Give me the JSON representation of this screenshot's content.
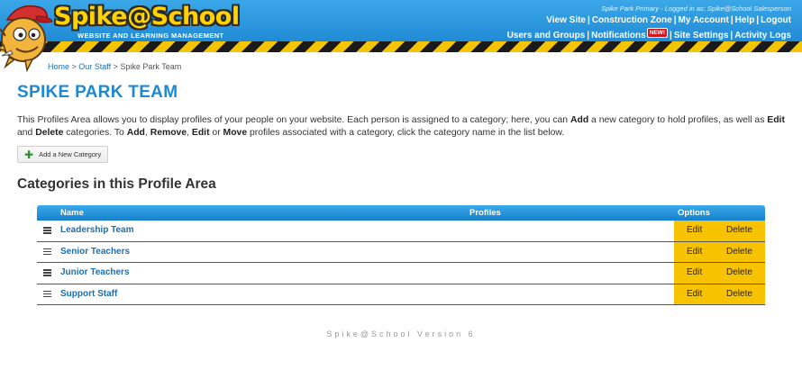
{
  "header": {
    "logo_main": "Spike@School",
    "logo_sub": "WEBSITE AND LEARNING MANAGEMENT",
    "user_info": "Spike Park Primary - Logged in as: Spike@School Salesperson",
    "nav_row1": [
      "View Site",
      "Construction Zone",
      "My Account",
      "Help",
      "Logout"
    ],
    "nav_row2": {
      "users_groups": "Users and Groups",
      "notifications": "Notifications",
      "new_badge": "NEW!",
      "site_settings": "Site Settings",
      "activity_logs": "Activity Logs"
    }
  },
  "breadcrumb": {
    "home": "Home",
    "sep1": " > ",
    "staff": "Our Staff",
    "sep2": " > ",
    "current": "Spike Park Team"
  },
  "page": {
    "title": "SPIKE PARK TEAM",
    "intro": {
      "p1": "This Profiles Area allows you to display profiles of your people on your website. Each person is assigned to a category; here, you can ",
      "b1": "Add",
      "p2": " a new category to hold profiles, as well as ",
      "b2": "Edit",
      "p3": " and ",
      "b3": "Delete",
      "p4": " categories. To ",
      "b4": "Add",
      "p5": ", ",
      "b5": "Remove",
      "p6": ", ",
      "b6": "Edit",
      "p7": " or ",
      "b7": "Move",
      "p8": " profiles associated with a category, click the category name in the list below."
    },
    "add_button": "Add a New Category",
    "section_title": "Categories in this Profile Area"
  },
  "table": {
    "headers": {
      "name": "Name",
      "profiles": "Profiles",
      "options": "Options"
    },
    "rows": [
      {
        "name": "Leadership Team",
        "edit": "Edit",
        "delete": "Delete"
      },
      {
        "name": "Senior Teachers",
        "edit": "Edit",
        "delete": "Delete"
      },
      {
        "name": "Junior Teachers",
        "edit": "Edit",
        "delete": "Delete"
      },
      {
        "name": "Support Staff",
        "edit": "Edit",
        "delete": "Delete"
      }
    ]
  },
  "footer": {
    "version": "Spike@School Version 6"
  },
  "colors": {
    "header_blue": "#1a84cf",
    "title_blue": "#1e88d3",
    "link_blue": "#1a6fb5",
    "options_yellow": "#f7c200",
    "badge_red": "#d7141a"
  },
  "icons": {
    "mascot": "mascot-icon",
    "add": "plus-icon",
    "drag": "drag-handle-icon"
  }
}
